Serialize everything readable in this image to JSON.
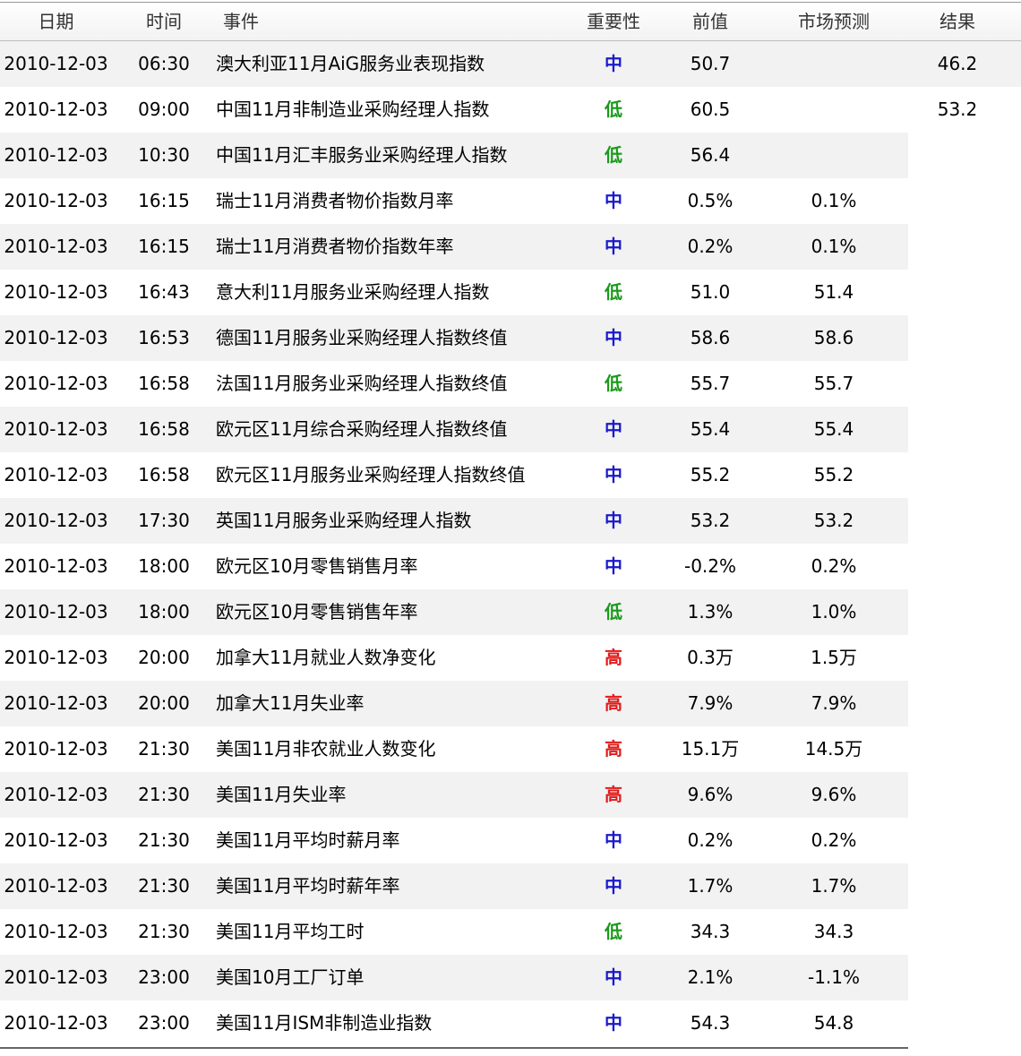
{
  "header": {
    "date": "日期",
    "time": "时间",
    "event": "事件",
    "importance": "重要性",
    "previous": "前值",
    "forecast": "市场预测",
    "result": "结果"
  },
  "colors": {
    "low": "#1a9a1a",
    "medium": "#1a1acc",
    "high": "#e01b1b",
    "stripe": "#f2f2f2"
  },
  "rows": [
    {
      "date": "2010-12-03",
      "time": "06:30",
      "event": "澳大利亚11月AiG服务业表现指数",
      "importance": "中",
      "level": "medium",
      "previous": "50.7",
      "forecast": "",
      "result": "46.2"
    },
    {
      "date": "2010-12-03",
      "time": "09:00",
      "event": "中国11月非制造业采购经理人指数",
      "importance": "低",
      "level": "low",
      "previous": "60.5",
      "forecast": "",
      "result": "53.2"
    },
    {
      "date": "2010-12-03",
      "time": "10:30",
      "event": "中国11月汇丰服务业采购经理人指数",
      "importance": "低",
      "level": "low",
      "previous": "56.4",
      "forecast": "",
      "result": ""
    },
    {
      "date": "2010-12-03",
      "time": "16:15",
      "event": "瑞士11月消费者物价指数月率",
      "importance": "中",
      "level": "medium",
      "previous": "0.5%",
      "forecast": "0.1%",
      "result": ""
    },
    {
      "date": "2010-12-03",
      "time": "16:15",
      "event": "瑞士11月消费者物价指数年率",
      "importance": "中",
      "level": "medium",
      "previous": "0.2%",
      "forecast": "0.1%",
      "result": ""
    },
    {
      "date": "2010-12-03",
      "time": "16:43",
      "event": "意大利11月服务业采购经理人指数",
      "importance": "低",
      "level": "low",
      "previous": "51.0",
      "forecast": "51.4",
      "result": ""
    },
    {
      "date": "2010-12-03",
      "time": "16:53",
      "event": "德国11月服务业采购经理人指数终值",
      "importance": "中",
      "level": "medium",
      "previous": "58.6",
      "forecast": "58.6",
      "result": ""
    },
    {
      "date": "2010-12-03",
      "time": "16:58",
      "event": "法国11月服务业采购经理人指数终值",
      "importance": "低",
      "level": "low",
      "previous": "55.7",
      "forecast": "55.7",
      "result": ""
    },
    {
      "date": "2010-12-03",
      "time": "16:58",
      "event": "欧元区11月综合采购经理人指数终值",
      "importance": "中",
      "level": "medium",
      "previous": "55.4",
      "forecast": "55.4",
      "result": ""
    },
    {
      "date": "2010-12-03",
      "time": "16:58",
      "event": "欧元区11月服务业采购经理人指数终值",
      "importance": "中",
      "level": "medium",
      "previous": "55.2",
      "forecast": "55.2",
      "result": ""
    },
    {
      "date": "2010-12-03",
      "time": "17:30",
      "event": "英国11月服务业采购经理人指数",
      "importance": "中",
      "level": "medium",
      "previous": "53.2",
      "forecast": "53.2",
      "result": ""
    },
    {
      "date": "2010-12-03",
      "time": "18:00",
      "event": "欧元区10月零售销售月率",
      "importance": "中",
      "level": "medium",
      "previous": "-0.2%",
      "forecast": "0.2%",
      "result": ""
    },
    {
      "date": "2010-12-03",
      "time": "18:00",
      "event": "欧元区10月零售销售年率",
      "importance": "低",
      "level": "low",
      "previous": "1.3%",
      "forecast": "1.0%",
      "result": ""
    },
    {
      "date": "2010-12-03",
      "time": "20:00",
      "event": "加拿大11月就业人数净变化",
      "importance": "高",
      "level": "high",
      "previous": "0.3万",
      "forecast": "1.5万",
      "result": ""
    },
    {
      "date": "2010-12-03",
      "time": "20:00",
      "event": "加拿大11月失业率",
      "importance": "高",
      "level": "high",
      "previous": "7.9%",
      "forecast": "7.9%",
      "result": ""
    },
    {
      "date": "2010-12-03",
      "time": "21:30",
      "event": "美国11月非农就业人数变化",
      "importance": "高",
      "level": "high",
      "previous": "15.1万",
      "forecast": "14.5万",
      "result": ""
    },
    {
      "date": "2010-12-03",
      "time": "21:30",
      "event": "美国11月失业率",
      "importance": "高",
      "level": "high",
      "previous": "9.6%",
      "forecast": "9.6%",
      "result": ""
    },
    {
      "date": "2010-12-03",
      "time": "21:30",
      "event": "美国11月平均时薪月率",
      "importance": "中",
      "level": "medium",
      "previous": "0.2%",
      "forecast": "0.2%",
      "result": ""
    },
    {
      "date": "2010-12-03",
      "time": "21:30",
      "event": "美国11月平均时薪年率",
      "importance": "中",
      "level": "medium",
      "previous": "1.7%",
      "forecast": "1.7%",
      "result": ""
    },
    {
      "date": "2010-12-03",
      "time": "21:30",
      "event": "美国11月平均工时",
      "importance": "低",
      "level": "low",
      "previous": "34.3",
      "forecast": "34.3",
      "result": ""
    },
    {
      "date": "2010-12-03",
      "time": "23:00",
      "event": "美国10月工厂订单",
      "importance": "中",
      "level": "medium",
      "previous": "2.1%",
      "forecast": "-1.1%",
      "result": ""
    },
    {
      "date": "2010-12-03",
      "time": "23:00",
      "event": "美国11月ISM非制造业指数",
      "importance": "中",
      "level": "medium",
      "previous": "54.3",
      "forecast": "54.8",
      "result": ""
    }
  ]
}
